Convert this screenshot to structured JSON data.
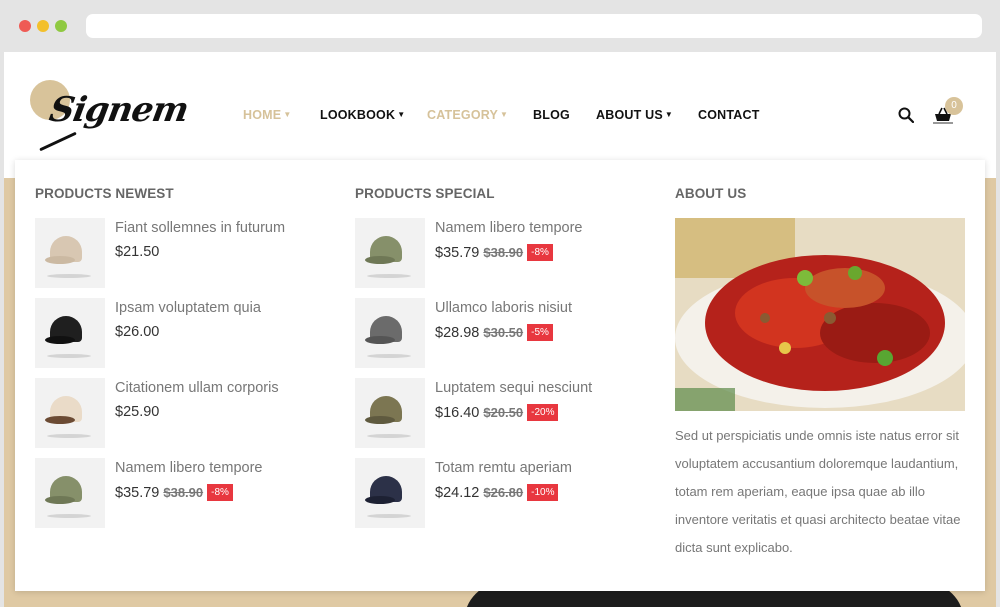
{
  "header": {
    "logo_text": "Signem",
    "nav": [
      {
        "label": "HOME",
        "caret": true,
        "active": true
      },
      {
        "label": "LOOKBOOK",
        "caret": true,
        "active": false
      },
      {
        "label": "CATEGORY",
        "caret": true,
        "active": true
      },
      {
        "label": "BLOG",
        "caret": false,
        "active": false
      },
      {
        "label": "ABOUT US",
        "caret": true,
        "active": false
      },
      {
        "label": "CONTACT",
        "caret": false,
        "active": false
      }
    ],
    "cart_count": "0",
    "search_icon": "search-icon",
    "cart_icon": "basket-icon"
  },
  "mega_menu": {
    "newest": {
      "title": "PRODUCTS NEWEST",
      "items": [
        {
          "name": "Fiant sollemnes in futurum",
          "price": "$21.50",
          "color": "#d8c7b2"
        },
        {
          "name": "Ipsam voluptatem quia",
          "price": "$26.00",
          "color": "#1f1f1f"
        },
        {
          "name": "Citationem ullam corporis",
          "price": "$25.90",
          "color": "#eadbc8"
        },
        {
          "name": "Namem libero tempore",
          "price": "$35.79",
          "old_price": "$38.90",
          "discount": "-8%",
          "color": "#86906a"
        }
      ]
    },
    "special": {
      "title": "PRODUCTS SPECIAL",
      "items": [
        {
          "name": "Namem libero tempore",
          "price": "$35.79",
          "old_price": "$38.90",
          "discount": "-8%",
          "color": "#86906a"
        },
        {
          "name": "Ullamco laboris nisiut",
          "price": "$28.98",
          "old_price": "$30.50",
          "discount": "-5%",
          "color": "#6b6b6b"
        },
        {
          "name": "Luptatem sequi nesciunt",
          "price": "$16.40",
          "old_price": "$20.50",
          "discount": "-20%",
          "color": "#7c7652"
        },
        {
          "name": "Totam remtu aperiam",
          "price": "$24.12",
          "old_price": "$26.80",
          "discount": "-10%",
          "color": "#2c3148"
        }
      ]
    },
    "about": {
      "title": "ABOUT US",
      "text": "Sed ut perspiciatis unde omnis iste natus error sit voluptatem accusantium doloremque laudantium, totam rem aperiam, eaque ipsa quae ab illo inventore veritatis et quasi architecto beatae vitae dicta sunt explicabo."
    }
  },
  "colors": {
    "accent": "#d6c29a",
    "discount": "#e8373f",
    "hero": "#dfc9a3"
  }
}
